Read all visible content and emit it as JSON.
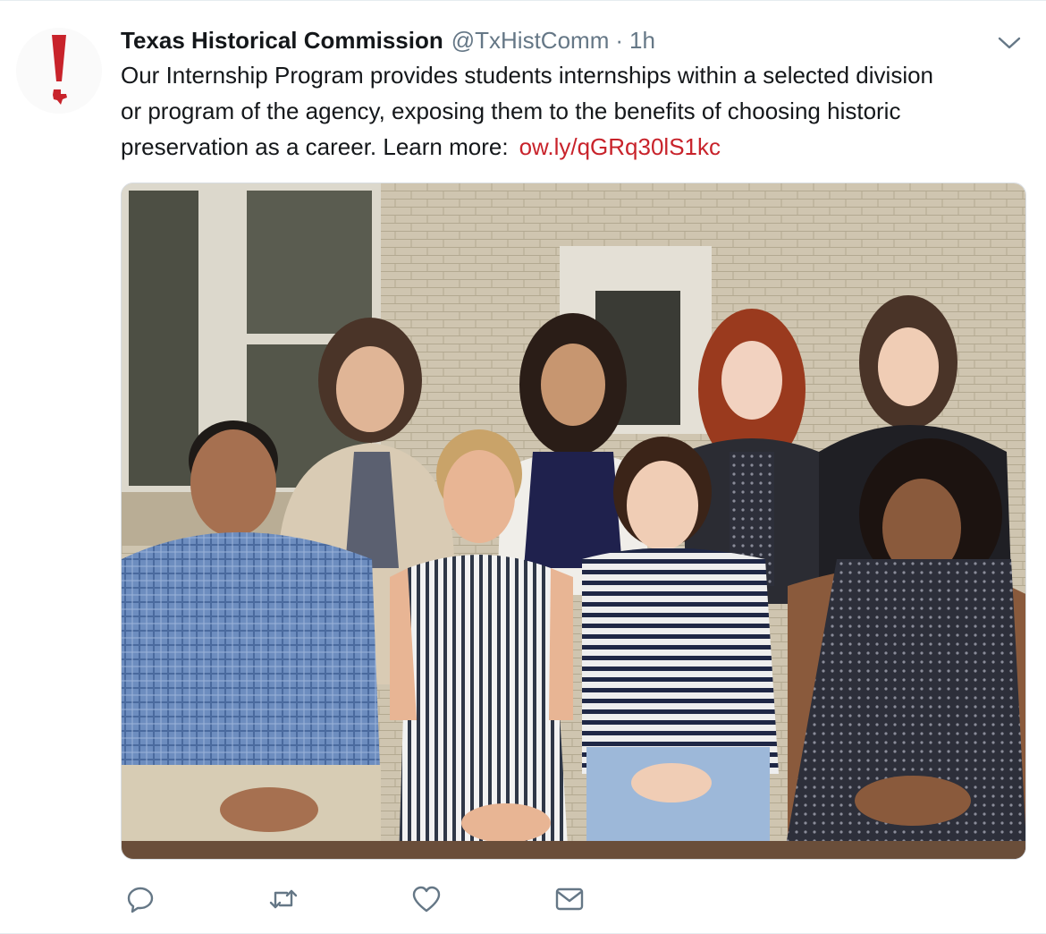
{
  "tweet": {
    "author": {
      "display_name": "Texas Historical Commission",
      "handle": "@TxHistComm",
      "separator": "·",
      "time": "1h",
      "avatar": "texas-exclamation-logo",
      "brand_color": "#c8232b"
    },
    "text": {
      "line1": "Our Internship Program provides students internships within a selected division",
      "line2": "or program of the agency, exposing them to the benefits of choosing historic",
      "line3_prefix": "preservation as a career. Learn more:",
      "link": "ow.ly/qGRq30lS1kc"
    },
    "menu_icon": "chevron-down-icon",
    "media": {
      "type": "photo",
      "icon": "group-photo"
    },
    "actions": [
      {
        "name": "reply",
        "icon": "reply-icon"
      },
      {
        "name": "retweet",
        "icon": "retweet-icon"
      },
      {
        "name": "like",
        "icon": "heart-icon"
      },
      {
        "name": "direct-message",
        "icon": "envelope-icon"
      }
    ],
    "colors": {
      "text": "#14171a",
      "secondary": "#657786",
      "link": "#c8232b",
      "icon": "#657786",
      "divider": "#e6ecf0"
    }
  }
}
